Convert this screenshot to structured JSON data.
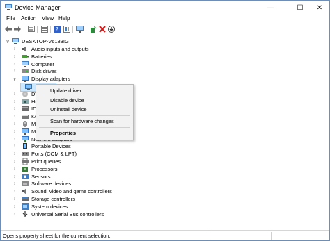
{
  "window": {
    "title": "Device Manager"
  },
  "menu": [
    "File",
    "Action",
    "View",
    "Help"
  ],
  "toolbar": [
    "back-icon",
    "forward-icon",
    "show-hidden-icon",
    "properties-icon",
    "help-icon",
    "action-view-icon",
    "monitor-icon",
    "update-driver-icon",
    "uninstall-icon",
    "download-icon"
  ],
  "tree": {
    "root": "DESKTOP-V6183IG",
    "nodes": [
      {
        "label": "Audio inputs and outputs",
        "icon": "speaker-icon"
      },
      {
        "label": "Batteries",
        "icon": "battery-icon"
      },
      {
        "label": "Computer",
        "icon": "computer-icon"
      },
      {
        "label": "Disk drives",
        "icon": "disk-drive-icon"
      },
      {
        "label": "Display adapters",
        "icon": "display-adapter-icon",
        "expanded": true
      },
      {
        "label": "",
        "icon": "display-adapter-icon",
        "child": true,
        "selected": true
      },
      {
        "label": "DVD/CD-ROM drives",
        "icon": "dvd-icon"
      },
      {
        "label": "Human Interface Devices",
        "icon": "hid-icon"
      },
      {
        "label": "IDE ATA/ATAPI controllers",
        "icon": "ide-icon"
      },
      {
        "label": "Keyboards",
        "icon": "keyboard-icon"
      },
      {
        "label": "Mice and other pointing devices",
        "icon": "mouse-icon"
      },
      {
        "label": "Monitors",
        "icon": "monitor-icon"
      },
      {
        "label": "Network adapters",
        "icon": "network-icon"
      },
      {
        "label": "Portable Devices",
        "icon": "portable-device-icon"
      },
      {
        "label": "Ports (COM & LPT)",
        "icon": "port-icon"
      },
      {
        "label": "Print queues",
        "icon": "printer-icon"
      },
      {
        "label": "Processors",
        "icon": "processor-icon"
      },
      {
        "label": "Sensors",
        "icon": "sensor-icon"
      },
      {
        "label": "Software devices",
        "icon": "software-device-icon"
      },
      {
        "label": "Sound, video and game controllers",
        "icon": "speaker-icon"
      },
      {
        "label": "Storage controllers",
        "icon": "storage-icon"
      },
      {
        "label": "System devices",
        "icon": "system-icon"
      },
      {
        "label": "Universal Serial Bus controllers",
        "icon": "usb-icon"
      }
    ]
  },
  "context_menu": {
    "items": [
      "Update driver",
      "Disable device",
      "Uninstall device",
      "Scan for hardware changes",
      "Properties"
    ]
  },
  "status": {
    "text": "Opens property sheet for the current selection."
  },
  "colors": {
    "accent": "#0078d7",
    "selection": "#cce8ff",
    "menu_bg": "#f2f2f2"
  }
}
